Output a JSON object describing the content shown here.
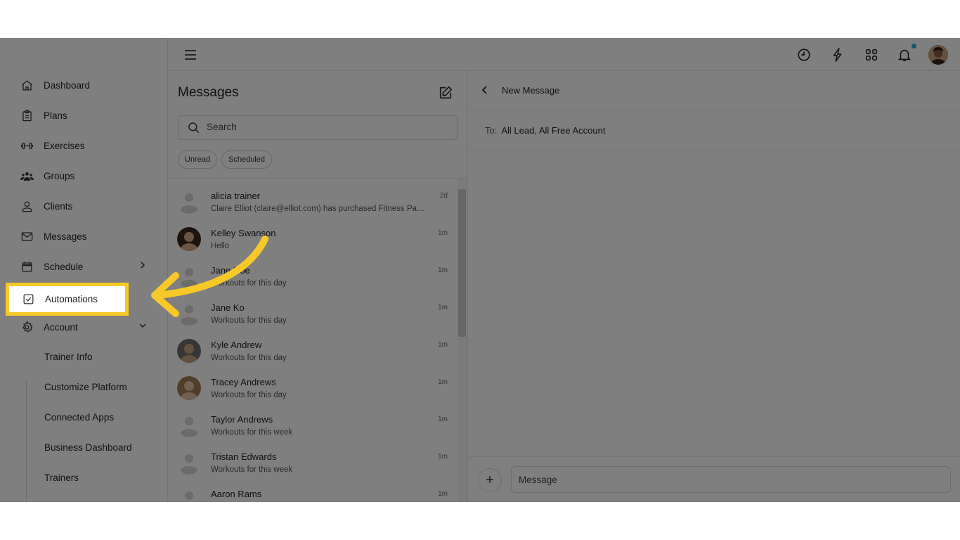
{
  "sidebar": {
    "items": [
      {
        "label": "Dashboard"
      },
      {
        "label": "Plans"
      },
      {
        "label": "Exercises"
      },
      {
        "label": "Groups"
      },
      {
        "label": "Clients"
      },
      {
        "label": "Messages"
      },
      {
        "label": "Schedule"
      },
      {
        "label": "Automations"
      },
      {
        "label": "Account"
      }
    ],
    "account_sub": [
      {
        "label": "Trainer Info"
      },
      {
        "label": "Customize Platform"
      },
      {
        "label": "Connected Apps"
      },
      {
        "label": "Business Dashboard"
      },
      {
        "label": "Trainers"
      }
    ]
  },
  "messages": {
    "title": "Messages",
    "search_placeholder": "Search",
    "filters": [
      "Unread",
      "Scheduled"
    ],
    "conversations": [
      {
        "name": "alicia trainer",
        "preview": "Claire Elliot (claire@elliot.com) has purchased Fitness Package",
        "time": "2d",
        "avatar": "placeholder"
      },
      {
        "name": "Kelley Swanson",
        "preview": "Hello",
        "time": "1m",
        "avatar": "photo"
      },
      {
        "name": "Jane Doe",
        "preview": "Workouts for this day",
        "time": "1m",
        "avatar": "placeholder"
      },
      {
        "name": "Jane Ko",
        "preview": "Workouts for this day",
        "time": "1m",
        "avatar": "placeholder"
      },
      {
        "name": "Kyle Andrew",
        "preview": "Workouts for this day",
        "time": "1m",
        "avatar": "photo"
      },
      {
        "name": "Tracey Andrews",
        "preview": "Workouts for this day",
        "time": "1m",
        "avatar": "photo"
      },
      {
        "name": "Taylor Andrews",
        "preview": "Workouts for this week",
        "time": "1m",
        "avatar": "placeholder"
      },
      {
        "name": "Tristan Edwards",
        "preview": "Workouts for this week",
        "time": "1m",
        "avatar": "placeholder"
      },
      {
        "name": "Aaron Rams",
        "preview": "",
        "time": "1m",
        "avatar": "placeholder"
      }
    ]
  },
  "detail": {
    "title": "New Message",
    "to_label": "To:",
    "to_value": "All Lead, All Free Account",
    "message_placeholder": "Message",
    "add_symbol": "+"
  },
  "colors": {
    "highlight": "#f6c928",
    "notification_dot": "#25b4d4",
    "overlay": "rgba(0,0,0,0.5)"
  }
}
